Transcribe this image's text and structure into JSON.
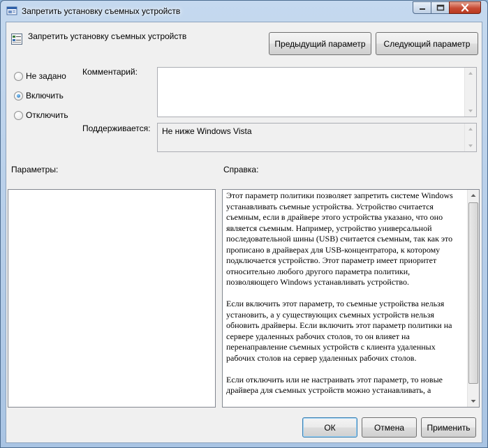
{
  "window": {
    "title": "Запретить установку съемных устройств"
  },
  "header": {
    "policy_name": "Запретить установку съемных устройств",
    "prev_button": "Предыдущий параметр",
    "next_button": "Следующий параметр"
  },
  "state": {
    "options": [
      {
        "label": "Не задано",
        "checked": false
      },
      {
        "label": "Включить",
        "checked": true
      },
      {
        "label": "Отключить",
        "checked": false
      }
    ]
  },
  "comment": {
    "label": "Комментарий:",
    "value": ""
  },
  "supported": {
    "label": "Поддерживается:",
    "value": "Не ниже Windows Vista"
  },
  "params": {
    "label": "Параметры:"
  },
  "help": {
    "label": "Справка:",
    "paragraphs": [
      "Этот параметр политики позволяет запретить системе Windows устанавливать съемные устройства. Устройство считается съемным, если в драйвере этого устройства указано, что оно является съемным. Например, устройство универсальной последовательной шины (USB) считается съемным, так как это прописано в драйверах для USB-концентратора, к которому подключается устройство. Этот параметр имеет приоритет относительно любого другого параметра политики, позволяющего Windows устанавливать устройство.",
      "Если включить этот параметр, то съемные устройства нельзя установить, а у существующих съемных устройств нельзя обновить драйверы. Если включить этот параметр политики на сервере удаленных рабочих столов, то он влияет на перенаправление съемных устройств с клиента удаленных рабочих столов на сервер удаленных рабочих столов.",
      "Если отключить или не настраивать этот параметр, то новые драйвера для съемных устройств можно устанавливать, а"
    ]
  },
  "footer": {
    "ok": "ОК",
    "cancel": "Отмена",
    "apply": "Применить"
  }
}
